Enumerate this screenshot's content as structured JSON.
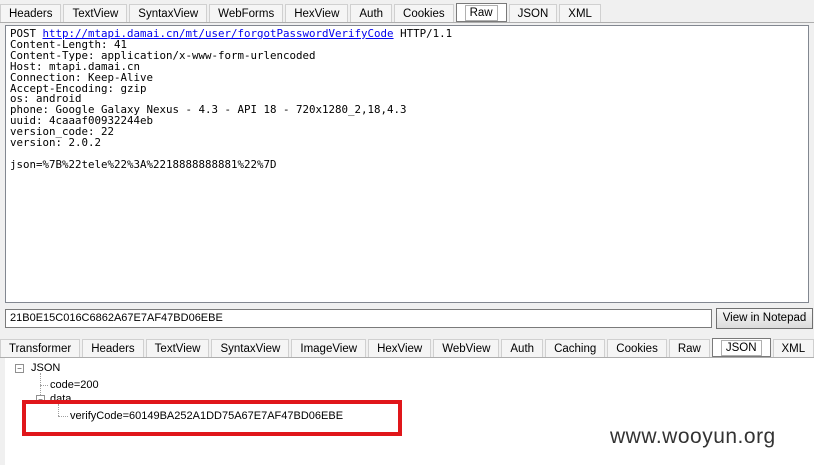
{
  "request_tabs": [
    "Headers",
    "TextView",
    "SyntaxView",
    "WebForms",
    "HexView",
    "Auth",
    "Cookies",
    "Raw",
    "JSON",
    "XML"
  ],
  "request_active_tab": "Raw",
  "raw_request": {
    "line1_method": "POST",
    "line1_url": "http://mtapi.damai.cn/mt/user/forgotPasswordVerifyCode",
    "line1_version": "HTTP/1.1",
    "headers_text": "Content-Length: 41\nContent-Type: application/x-www-form-urlencoded\nHost: mtapi.damai.cn\nConnection: Keep-Alive\nAccept-Encoding: gzip\nos: android\nphone: Google Galaxy Nexus - 4.3 - API 18 - 720x1280_2,18,4.3\nuuid: 4caaaf00932244eb\nversion_code: 22\nversion: 2.0.2\n\njson=%7B%22tele%22%3A%2218888888881%22%7D"
  },
  "hash_field": "21B0E15C016C6862A67E7AF47BD06EBE",
  "notepad_button": "View in Notepad",
  "response_tabs": [
    "Transformer",
    "Headers",
    "TextView",
    "SyntaxView",
    "ImageView",
    "HexView",
    "WebView",
    "Auth",
    "Caching",
    "Cookies",
    "Raw",
    "JSON",
    "XML"
  ],
  "response_active_tab": "JSON",
  "json_tree": {
    "root": "JSON",
    "code": "code=200",
    "data": "data",
    "verify": "verifyCode=60149BA252A1DD75A67E7AF47BD06EBE"
  },
  "watermark": "www.wooyun.org",
  "colors": {
    "highlight": "#e0161a",
    "link": "#0000ee"
  }
}
